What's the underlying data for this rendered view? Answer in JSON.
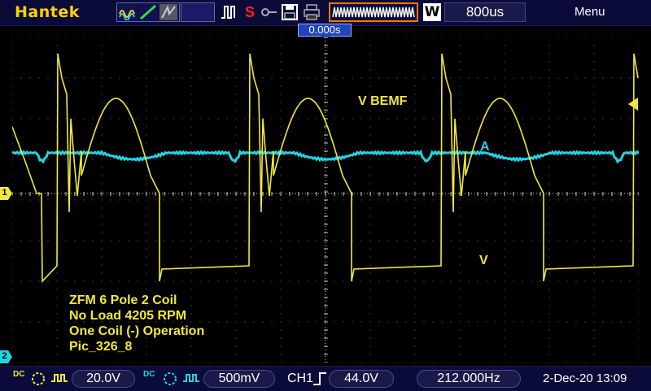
{
  "brand": "Hantek",
  "toolbar": {
    "run_mode_icon": "run-icon",
    "stop_label": "S",
    "timebase": "800us"
  },
  "menu_label": "Menu",
  "trigger_position": "0.000s",
  "markers": {
    "ch1": "1",
    "ch2": "2"
  },
  "annotations": {
    "bemf": "V BEMF",
    "current": "A",
    "voltage": "V"
  },
  "notes": [
    "ZFM 6 Pole 2 Coil",
    "No Load 4205 RPM",
    "One Coil (-) Operation",
    "Pic_326_8"
  ],
  "bottom": {
    "ch1_coupling": "DC",
    "ch1_scale": "20.0V",
    "ch2_coupling": "DC",
    "ch2_scale": "500mV",
    "trigger_source": "CH1",
    "trigger_level": "44.0V",
    "frequency": "212.000Hz",
    "datetime": "2-Dec-20 13:09"
  },
  "colors": {
    "ch1": "#f2e83a",
    "ch2": "#22d3e6",
    "grid": "#7a7a7a",
    "background": "#000000",
    "topbar": "#0b0b3a"
  }
}
